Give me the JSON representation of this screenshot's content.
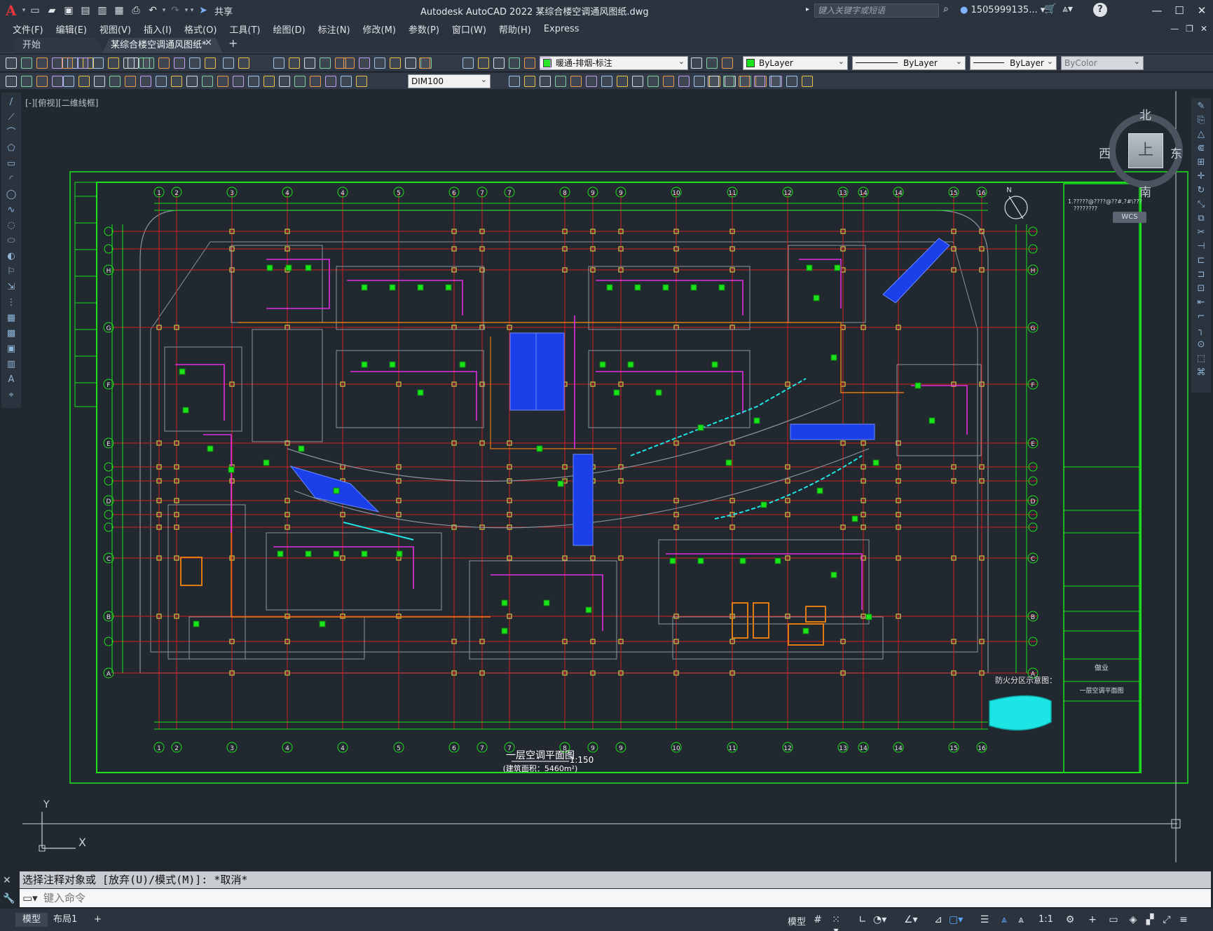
{
  "app": {
    "logo": "A",
    "title": "Autodesk AutoCAD 2022    某综合楼空调通风图纸.dwg",
    "share_label": "共享",
    "search_placeholder": "键入关键字或短语",
    "user": "1505999135...",
    "help": "?"
  },
  "window_controls": {
    "minimize": "—",
    "maximize": "☐",
    "close": "✕"
  },
  "menu": {
    "items": [
      "文件(F)",
      "编辑(E)",
      "视图(V)",
      "插入(I)",
      "格式(O)",
      "工具(T)",
      "绘图(D)",
      "标注(N)",
      "修改(M)",
      "参数(P)",
      "窗口(W)",
      "帮助(H)",
      "Express"
    ]
  },
  "tabs": {
    "start": "开始",
    "document": "某综合楼空调通风图纸*",
    "close": "✕",
    "add": "+"
  },
  "toolbar": {
    "layer": "暖通-排烟-标注",
    "color": "ByLayer",
    "linetype": "ByLayer",
    "lineweight": "ByLayer",
    "plotstyle": "ByColor",
    "dimstyle": "DIM100"
  },
  "viewport": {
    "label": "[-][俯视][二维线框]"
  },
  "viewcube": {
    "north": "北",
    "south": "南",
    "east": "东",
    "west": "西",
    "face": "上",
    "wcs": "WCS"
  },
  "drawing": {
    "title": "一层空调平面图",
    "area": "(建筑面积：5460m²)",
    "scale": "1:150",
    "north_label": "N",
    "fire_zone_label": "防火分区示意图：",
    "grid_numbers": [
      "1",
      "2",
      "3",
      "4",
      "4",
      "5",
      "6",
      "7",
      "7",
      "8",
      "9",
      "9",
      "10",
      "11",
      "12",
      "13",
      "14",
      "14",
      "15",
      "16",
      "16"
    ],
    "grid_letters": [
      "H",
      "G",
      "F",
      "E",
      "D",
      "C",
      "B",
      "A"
    ],
    "titleblock_notes": "1.?????@????@??#,?#\\???",
    "titleblock_sub": "????????",
    "titleblock_name": "一层空调平面图",
    "titleblock_mark": "做业"
  },
  "ucs": {
    "y": "Y",
    "x": "X"
  },
  "command": {
    "history": "选择注释对象或 [放弃(U)/模式(M)]: *取消*",
    "placeholder": "键入命令"
  },
  "statusbar": {
    "model_tab": "模型",
    "layout_tab": "布局1",
    "add": "+",
    "model_space": "模型",
    "scale": "1:1"
  },
  "colors": {
    "green": "#1be21b",
    "red": "#d11f1f",
    "magenta": "#e02ee0",
    "blue": "#1b3fe8",
    "cyan": "#1ee5e5",
    "orange": "#e07b12",
    "yellow": "#d8c64a",
    "gray": "#8a939d"
  }
}
